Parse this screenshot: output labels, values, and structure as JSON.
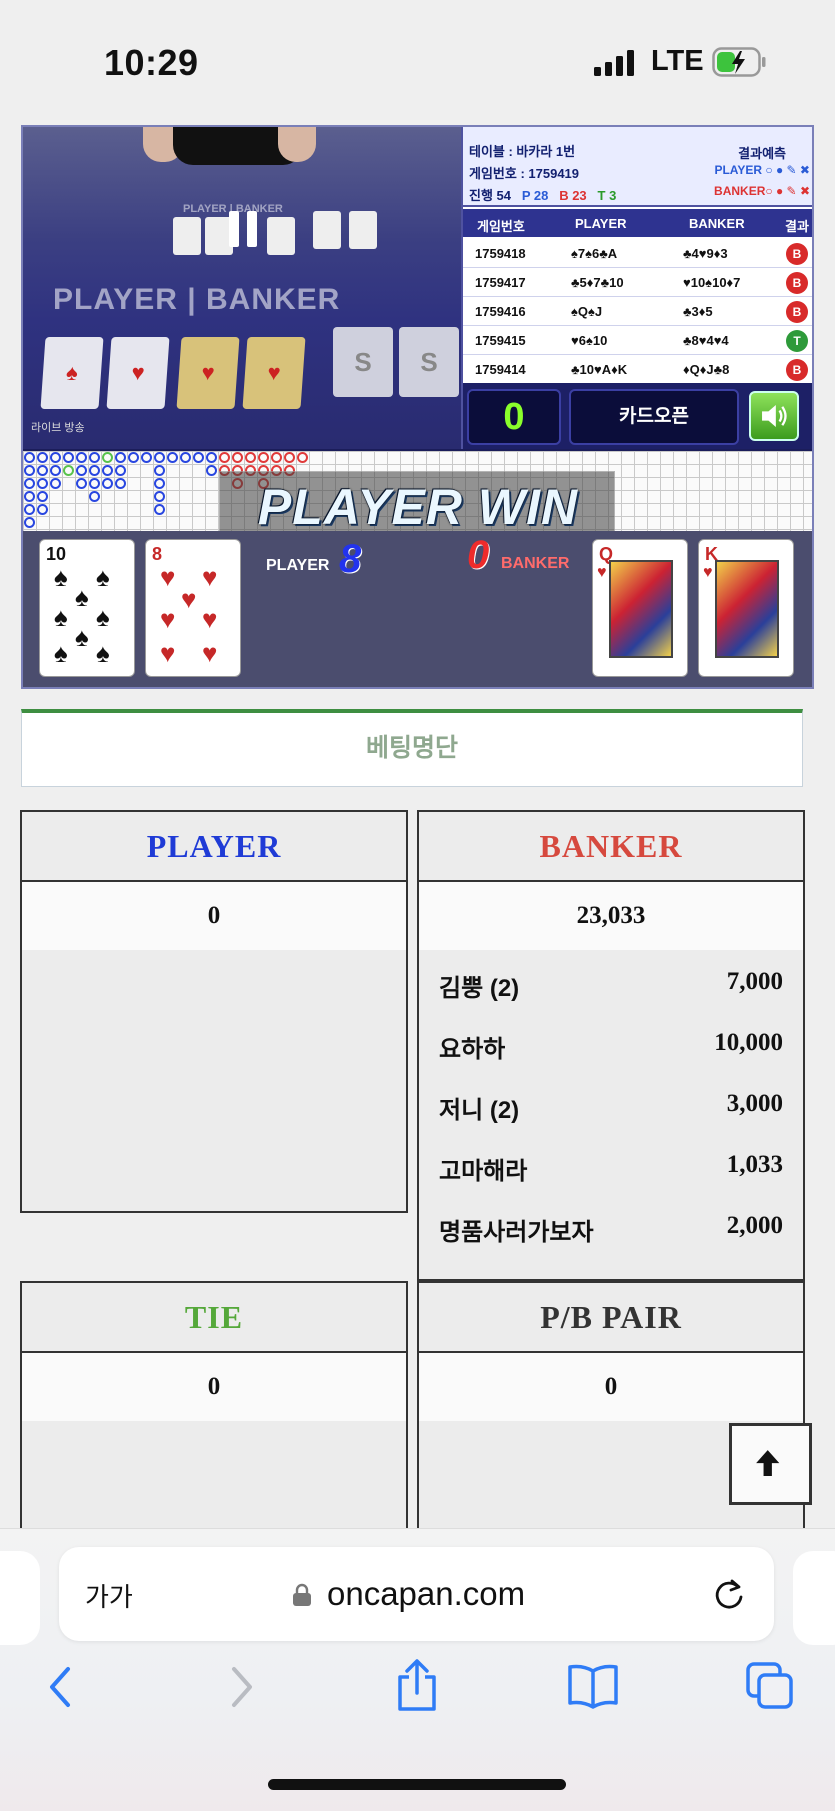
{
  "status": {
    "time": "10:29",
    "network": "LTE"
  },
  "video": {
    "live_label": "라이브 방송",
    "table_words": {
      "player": "PLAYER",
      "banker": "BANKER"
    },
    "info": {
      "table_line": "테이블 : 바카라 1번",
      "game_line": "게임번호 : 1759419",
      "progress_label": "진행 54",
      "p_count": "P 28",
      "b_count": "B 23",
      "t_count": "T 3",
      "predict_label": "결과예측",
      "predict_player": "PLAYER",
      "predict_banker": "BANKER"
    },
    "history_headers": [
      "게임번호",
      "PLAYER",
      "BANKER",
      "결과"
    ],
    "history": [
      {
        "game": "1759418",
        "player": "♠7♠6♣A",
        "banker": "♣4♥9♦3",
        "result": "B"
      },
      {
        "game": "1759417",
        "player": "♣5♦7♣10",
        "banker": "♥10♠10♦7",
        "result": "B"
      },
      {
        "game": "1759416",
        "player": "♠Q♠J",
        "banker": "♣3♦5",
        "result": "B"
      },
      {
        "game": "1759415",
        "player": "♥6♠10",
        "banker": "♣8♥4♥4",
        "result": "T"
      },
      {
        "game": "1759414",
        "player": "♣10♥A♦K",
        "banker": "♦Q♦J♣8",
        "result": "B"
      }
    ],
    "counter": "0",
    "open_card_button": "카드오픈",
    "win_banner": "PLAYER WIN",
    "player_label": "PLAYER",
    "player_score": "8",
    "banker_label": "BANKER",
    "banker_score": "0",
    "player_cards": [
      {
        "rank": "10",
        "suit": "♠"
      },
      {
        "rank": "8",
        "suit": "♥"
      }
    ],
    "banker_cards": [
      {
        "rank": "Q",
        "suit": "♥"
      },
      {
        "rank": "K",
        "suit": "♥"
      }
    ]
  },
  "betting": {
    "title": "베팅명단",
    "player": {
      "label": "PLAYER",
      "total": "0",
      "bets": []
    },
    "banker": {
      "label": "BANKER",
      "total": "23,033",
      "bets": [
        {
          "name": "김뿡 (2)",
          "amount": "7,000"
        },
        {
          "name": "요하하",
          "amount": "10,000"
        },
        {
          "name": "저니 (2)",
          "amount": "3,000"
        },
        {
          "name": "고마해라",
          "amount": "1,033"
        },
        {
          "name": "명품사러가보자",
          "amount": "2,000"
        }
      ]
    },
    "tie": {
      "label": "TIE",
      "total": "0"
    },
    "pair": {
      "label": "P/B PAIR",
      "total": "0"
    }
  },
  "browser": {
    "text_size": "가가",
    "url": "oncapan.com"
  },
  "colors": {
    "player": "#1f3bd6",
    "banker": "#d6493e",
    "tie": "#55a83a",
    "pair": "#333333",
    "counter": "#8aff2b"
  }
}
